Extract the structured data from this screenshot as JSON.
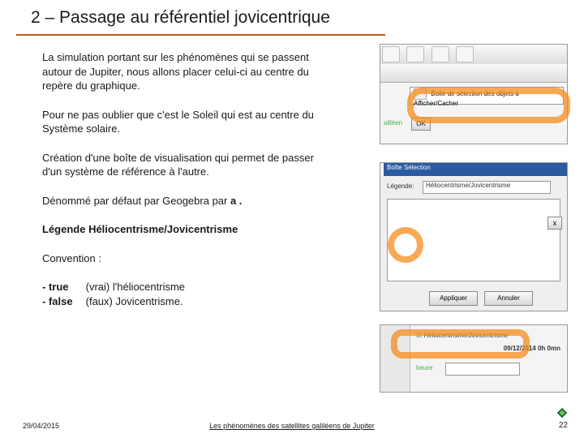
{
  "title": "2 – Passage au référentiel jovicentrique",
  "paragraphs": {
    "p1": "La simulation portant sur les phénomènes qui se passent autour de Jupiter, nous allons placer celui-ci au centre du repère du graphique.",
    "p2": "Pour ne pas oublier que c'est le Soleil qui est au centre du Système solaire.",
    "p3": "Création d'une boîte de visualisation qui permet de passer d'un système de référence à l'autre.",
    "p4_prefix": "Dénommé par défaut par Geogebra par ",
    "p4_bold": "a .",
    "p5": "Légende Héliocentrisme/Jovicentrisme",
    "p6": "Convention :",
    "p7_line1_key": "- true",
    "p7_line1_val": "(vrai) l'héliocentrisme",
    "p7_line2_key": "- false",
    "p7_line2_val": "(faux) Jovicentrisme."
  },
  "footer": {
    "date": "29/04/2015",
    "caption": "Les phénomènes des satellites galiléens de Jupiter",
    "pageno": "22"
  },
  "img1": {
    "row2_label": "Boite de sélection des objets à Afficher/Cacher",
    "ok": "OK",
    "tag": "aliléen"
  },
  "img2": {
    "title": "Boîte Sélection",
    "legend_label": "Légende:",
    "legend_value": "Héliocentrisme/Jovicentrisme",
    "btn_apply": "Appliquer",
    "btn_cancel": "Annuler",
    "x": "x"
  },
  "img3": {
    "check": "Héliocentrisme/Jovicentrisme",
    "date": "09/12/2014  0h 0mn",
    "label": "heure"
  }
}
